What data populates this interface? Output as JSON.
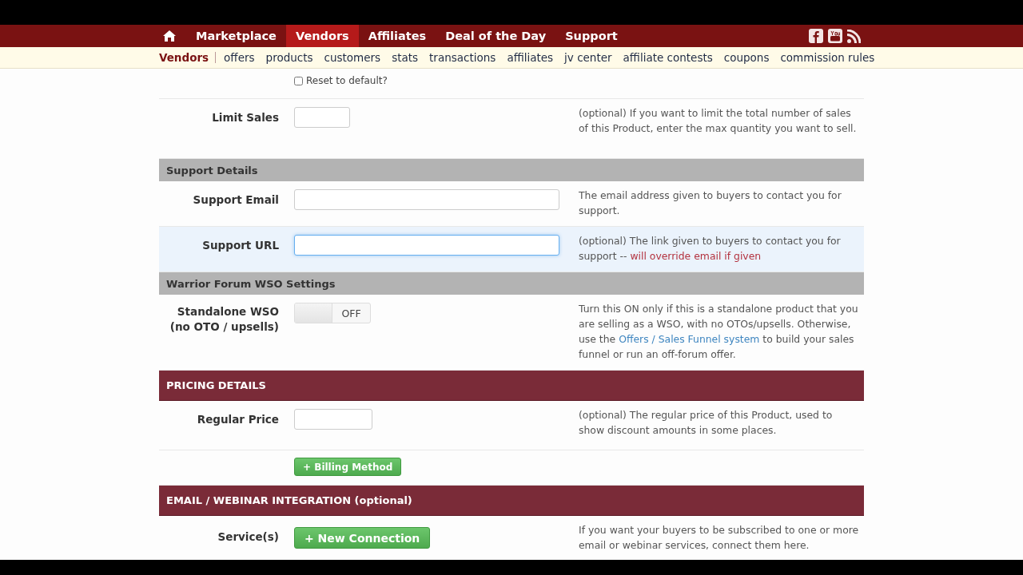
{
  "nav": {
    "items": [
      {
        "label": "Marketplace",
        "selected": false
      },
      {
        "label": "Vendors",
        "selected": true
      },
      {
        "label": "Affiliates",
        "selected": false
      },
      {
        "label": "Deal of the Day",
        "selected": false
      },
      {
        "label": "Support",
        "selected": false
      }
    ]
  },
  "subnav": {
    "title": "Vendors",
    "items": [
      "offers",
      "products",
      "customers",
      "stats",
      "transactions",
      "affiliates",
      "jv center",
      "affiliate contests",
      "coupons",
      "commission rules"
    ]
  },
  "form": {
    "rows": [
      {
        "kind": "checkbox",
        "label": "Reset to default?",
        "checked": false
      },
      {
        "kind": "input",
        "label": "Limit Sales",
        "focused": false,
        "help": [
          {
            "text": "(optional) If you want to limit the total number of sales of this Product, enter the max quantity you want to sell."
          }
        ]
      },
      {
        "kind": "subsection",
        "title": "Support Details"
      },
      {
        "kind": "input",
        "label": "Support Email",
        "focused": false,
        "help": [
          {
            "text": "The email address given to buyers to contact you for support."
          }
        ]
      },
      {
        "kind": "input",
        "label": "Support URL",
        "focused": true,
        "help": [
          {
            "text": "(optional) The link given to buyers to contact you for support -- "
          },
          {
            "text": "will override email if given",
            "kind": "warning"
          }
        ]
      },
      {
        "kind": "subsection",
        "title": "Warrior Forum WSO Settings"
      },
      {
        "kind": "toggle",
        "label": "Standalone WSO (no OTO / upsells)",
        "on": false,
        "state_label": "OFF",
        "help": [
          {
            "text": "Turn this ON only if this is a standalone product that you are selling as a WSO, with no OTOs/upsells. Otherwise, use the "
          },
          {
            "text": "Offers / Sales Funnel system",
            "kind": "link"
          },
          {
            "text": " to build your sales funnel or run an off-forum offer."
          }
        ]
      },
      {
        "kind": "section",
        "title": "PRICING DETAILS"
      },
      {
        "kind": "input",
        "label": "Regular Price",
        "focused": false,
        "help": [
          {
            "text": "(optional) The regular price of this Product, used to show discount amounts in some places."
          }
        ]
      },
      {
        "kind": "button",
        "label": "",
        "button": "+ Billing Method"
      },
      {
        "kind": "section",
        "title": "EMAIL / WEBINAR INTEGRATION (optional)"
      },
      {
        "kind": "button",
        "label": "Service(s)",
        "button": "+ New Connection",
        "help": [
          {
            "text": "If you want your buyers to be subscribed to one or more email or webinar services, connect them here."
          }
        ]
      }
    ]
  }
}
